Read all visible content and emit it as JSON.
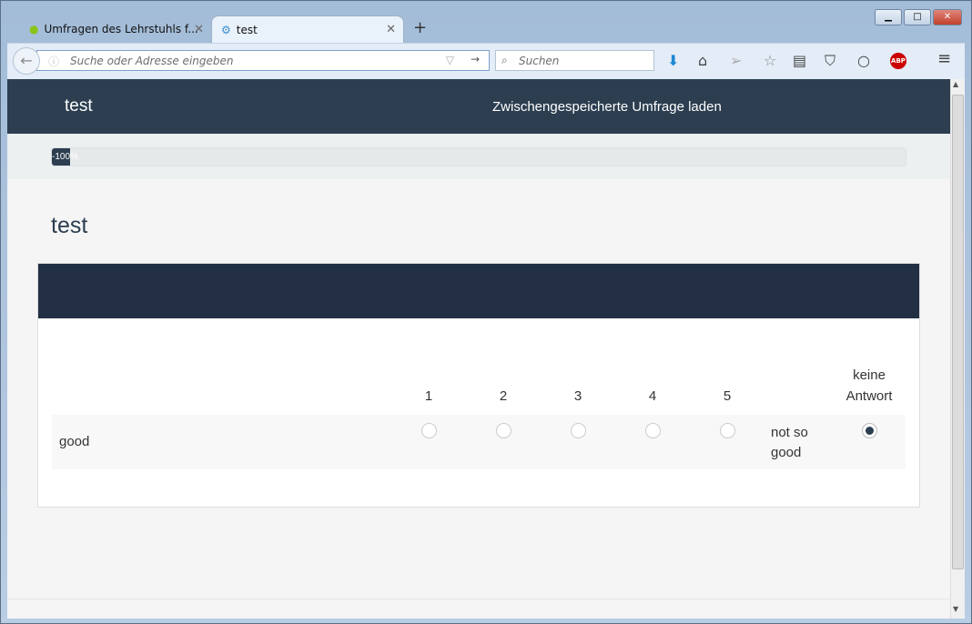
{
  "browser": {
    "tabs": [
      {
        "label": "Umfragen des Lehrstuhls f..."
      },
      {
        "label": "test"
      }
    ],
    "url_placeholder": "Suche oder Adresse eingeben",
    "search_placeholder": "Suchen"
  },
  "header": {
    "brand": "test",
    "load_link": "Zwischengespeicherte Umfrage laden"
  },
  "progress": {
    "label": "-100%",
    "value_percent": 2
  },
  "survey": {
    "title": "test",
    "columns": [
      "1",
      "2",
      "3",
      "4",
      "5"
    ],
    "no_answer_label_1": "keine",
    "no_answer_label_2": "Antwort",
    "row": {
      "left_label": "good",
      "right_label": "not so good",
      "selected": "keine Antwort"
    }
  },
  "colors": {
    "primary": "#2c3e50",
    "card_header": "#233044"
  }
}
